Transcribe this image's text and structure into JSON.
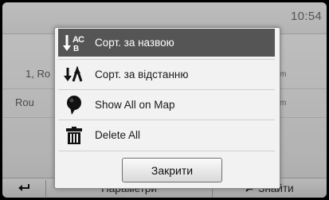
{
  "status": {
    "time": "10:54"
  },
  "background_list": {
    "rows": [
      {
        "label": "1, Ro",
        "unit": "m"
      },
      {
        "label": "Rou",
        "unit": "m"
      }
    ]
  },
  "menu": {
    "items": [
      {
        "icon": "sort-alphabetical-icon",
        "label": "Сорт. за назвою",
        "highlighted": true
      },
      {
        "icon": "sort-distance-icon",
        "label": "Сорт. за відстанню",
        "highlighted": false
      },
      {
        "icon": "map-pin-icon",
        "label": "Show All on Map",
        "highlighted": false
      },
      {
        "icon": "trash-icon",
        "label": "Delete All",
        "highlighted": false
      }
    ],
    "close_label": "Закрити"
  },
  "bottom_bar": {
    "back_icon": "back-arrow-icon",
    "options_label": "Параметри",
    "search_icon": "search-icon",
    "search_label": "Знайти"
  },
  "colors": {
    "highlight": "#555555",
    "popup_bg": "#f2f2f2",
    "screen_bg": "#b8b8b8"
  }
}
